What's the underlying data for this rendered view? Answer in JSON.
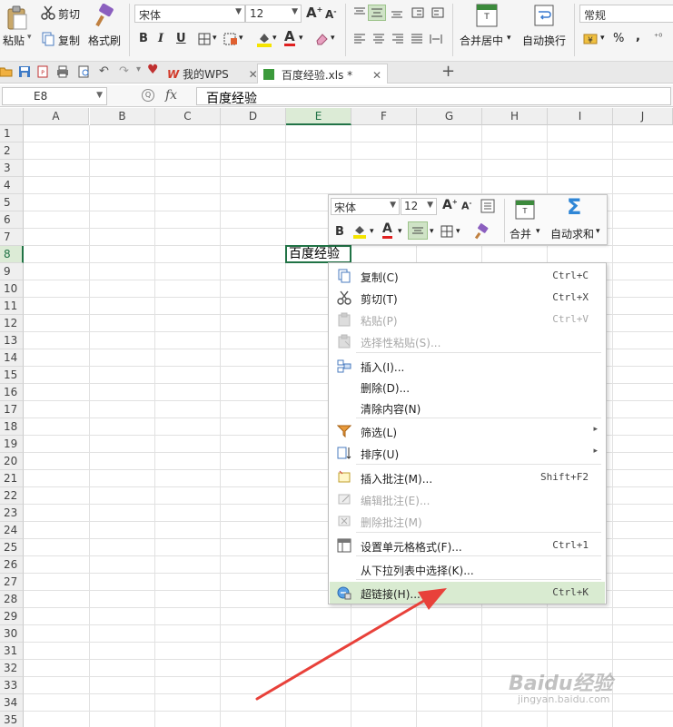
{
  "ribbon": {
    "paste": "粘贴",
    "cut": "剪切",
    "copy": "复制",
    "format_painter": "格式刷",
    "font_name": "宋体",
    "font_size": "12",
    "merge_center": "合并居中",
    "wrap_text": "自动换行",
    "number_format": "常规",
    "percent": "%"
  },
  "tabs": [
    {
      "label": "我的WPS"
    },
    {
      "label": "百度经验.xls *"
    }
  ],
  "formula_bar": {
    "name_box": "E8",
    "fx": "fx",
    "value": "百度经验"
  },
  "columns": [
    "A",
    "B",
    "C",
    "D",
    "E",
    "F",
    "G",
    "H",
    "I",
    "J"
  ],
  "rows": [
    "1",
    "2",
    "3",
    "4",
    "5",
    "6",
    "7",
    "8",
    "9",
    "10",
    "11",
    "12",
    "13",
    "14",
    "15",
    "16",
    "17",
    "18",
    "19",
    "20",
    "21",
    "22",
    "23",
    "24",
    "25",
    "26",
    "27",
    "28",
    "29",
    "30",
    "31",
    "32",
    "33",
    "34",
    "35"
  ],
  "active_cell": {
    "ref": "E8",
    "value": "百度经验"
  },
  "mini_toolbar": {
    "font_name": "宋体",
    "font_size": "12",
    "bold": "B",
    "merge": "合并",
    "autosum": "自动求和"
  },
  "context_menu": [
    {
      "label": "复制(C)",
      "shortcut": "Ctrl+C",
      "icon": "copy-icon",
      "disabled": false
    },
    {
      "label": "剪切(T)",
      "shortcut": "Ctrl+X",
      "icon": "scissors-icon",
      "disabled": false
    },
    {
      "label": "粘贴(P)",
      "shortcut": "Ctrl+V",
      "icon": "clipboard-icon",
      "disabled": true
    },
    {
      "label": "选择性粘贴(S)...",
      "shortcut": "",
      "icon": "paste-special-icon",
      "disabled": true
    },
    {
      "label": "插入(I)...",
      "shortcut": "",
      "icon": "insert-icon",
      "disabled": false
    },
    {
      "label": "删除(D)...",
      "shortcut": "",
      "icon": "",
      "disabled": false
    },
    {
      "label": "清除内容(N)",
      "shortcut": "",
      "icon": "",
      "disabled": false
    },
    {
      "label": "筛选(L)",
      "shortcut": "",
      "icon": "filter-icon",
      "disabled": false,
      "submenu": true
    },
    {
      "label": "排序(U)",
      "shortcut": "",
      "icon": "sort-icon",
      "disabled": false,
      "submenu": true
    },
    {
      "label": "插入批注(M)...",
      "shortcut": "Shift+F2",
      "icon": "comment-add-icon",
      "disabled": false
    },
    {
      "label": "编辑批注(E)...",
      "shortcut": "",
      "icon": "comment-edit-icon",
      "disabled": true
    },
    {
      "label": "删除批注(M)",
      "shortcut": "",
      "icon": "comment-delete-icon",
      "disabled": true
    },
    {
      "label": "设置单元格格式(F)...",
      "shortcut": "Ctrl+1",
      "icon": "format-cells-icon",
      "disabled": false
    },
    {
      "label": "从下拉列表中选择(K)...",
      "shortcut": "",
      "icon": "",
      "disabled": false
    },
    {
      "label": "超链接(H)...",
      "shortcut": "Ctrl+K",
      "icon": "hyperlink-icon",
      "disabled": false,
      "highlighted": true
    }
  ],
  "watermark": {
    "main": "Baidu经验",
    "sub": "jingyan.baidu.com"
  },
  "colors": {
    "accent": "#217346",
    "highlight": "#d9ebd1",
    "arrow": "#e8413a"
  }
}
